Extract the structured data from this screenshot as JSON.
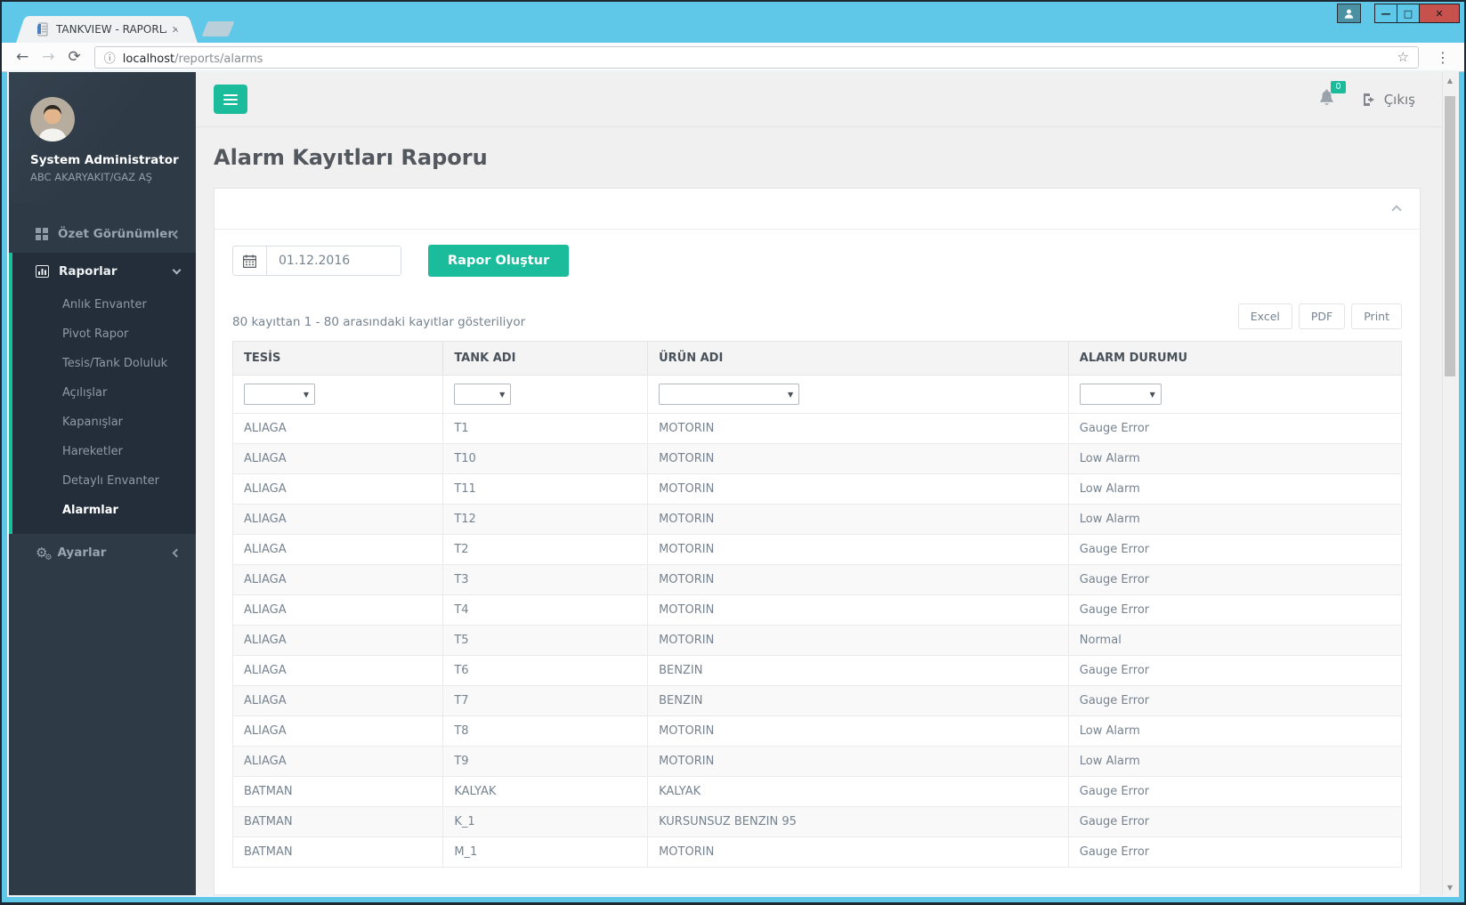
{
  "window": {
    "tab_title": "TANKVIEW - RAPORLAR",
    "url_host": "localhost",
    "url_path": "/reports/alarms"
  },
  "icons": {
    "back": "←",
    "forward": "→",
    "refresh": "⟳",
    "info": "ⓘ",
    "star": "☆",
    "menu_dots": "⋮",
    "tab_close": "✕",
    "minimize": "—",
    "maximize": "□",
    "close": "✕",
    "gear": "⚙",
    "gear_small": "⚙",
    "select_arrow": "▼",
    "scroll_up": "▲",
    "scroll_down": "▼"
  },
  "sidebar": {
    "user": {
      "name": "System Administrator",
      "company": "ABC AKARYAKIT/GAZ AŞ"
    },
    "overview_label": "Özet Görünümler",
    "reports_label": "Raporlar",
    "settings_label": "Ayarlar",
    "report_items": [
      {
        "label": "Anlık Envanter",
        "active": false
      },
      {
        "label": "Pivot Rapor",
        "active": false
      },
      {
        "label": "Tesis/Tank Doluluk",
        "active": false
      },
      {
        "label": "Açılışlar",
        "active": false
      },
      {
        "label": "Kapanışlar",
        "active": false
      },
      {
        "label": "Hareketler",
        "active": false
      },
      {
        "label": "Detaylı Envanter",
        "active": false
      },
      {
        "label": "Alarmlar",
        "active": true
      }
    ]
  },
  "topbar": {
    "notification_count": "0",
    "logout_label": "Çıkış"
  },
  "page": {
    "title": "Alarm Kayıtları Raporu"
  },
  "report_panel": {
    "date_value": "01.12.2016",
    "generate_button": "Rapor Oluştur",
    "records_info": "80 kayıttan 1 - 80 arasındaki kayıtlar gösteriliyor",
    "export_buttons": [
      {
        "label": "Excel"
      },
      {
        "label": "PDF"
      },
      {
        "label": "Print"
      }
    ]
  },
  "table": {
    "columns": [
      "TESİS",
      "TANK ADI",
      "ÜRÜN ADI",
      "ALARM DURUMU"
    ],
    "rows": [
      [
        "ALIAGA",
        "T1",
        "MOTORIN",
        "Gauge Error"
      ],
      [
        "ALIAGA",
        "T10",
        "MOTORIN",
        "Low Alarm"
      ],
      [
        "ALIAGA",
        "T11",
        "MOTORIN",
        "Low Alarm"
      ],
      [
        "ALIAGA",
        "T12",
        "MOTORIN",
        "Low Alarm"
      ],
      [
        "ALIAGA",
        "T2",
        "MOTORIN",
        "Gauge Error"
      ],
      [
        "ALIAGA",
        "T3",
        "MOTORIN",
        "Gauge Error"
      ],
      [
        "ALIAGA",
        "T4",
        "MOTORIN",
        "Gauge Error"
      ],
      [
        "ALIAGA",
        "T5",
        "MOTORIN",
        "Normal"
      ],
      [
        "ALIAGA",
        "T6",
        "BENZIN",
        "Gauge Error"
      ],
      [
        "ALIAGA",
        "T7",
        "BENZIN",
        "Gauge Error"
      ],
      [
        "ALIAGA",
        "T8",
        "MOTORIN",
        "Low Alarm"
      ],
      [
        "ALIAGA",
        "T9",
        "MOTORIN",
        "Low Alarm"
      ],
      [
        "BATMAN",
        "KALYAK",
        "KALYAK",
        "Gauge Error"
      ],
      [
        "BATMAN",
        "K_1",
        "KURSUNSUZ BENZIN 95",
        "Gauge Error"
      ],
      [
        "BATMAN",
        "M_1",
        "MOTORIN",
        "Gauge Error"
      ]
    ]
  },
  "colors": {
    "accent_teal": "#1abc9c",
    "sidebar_bg": "#2e3a46",
    "sidebar_active_bg": "#242e3a",
    "frame_blue": "#5fc8e8",
    "close_red": "#c7514d",
    "content_bg": "#f0f0f0"
  }
}
